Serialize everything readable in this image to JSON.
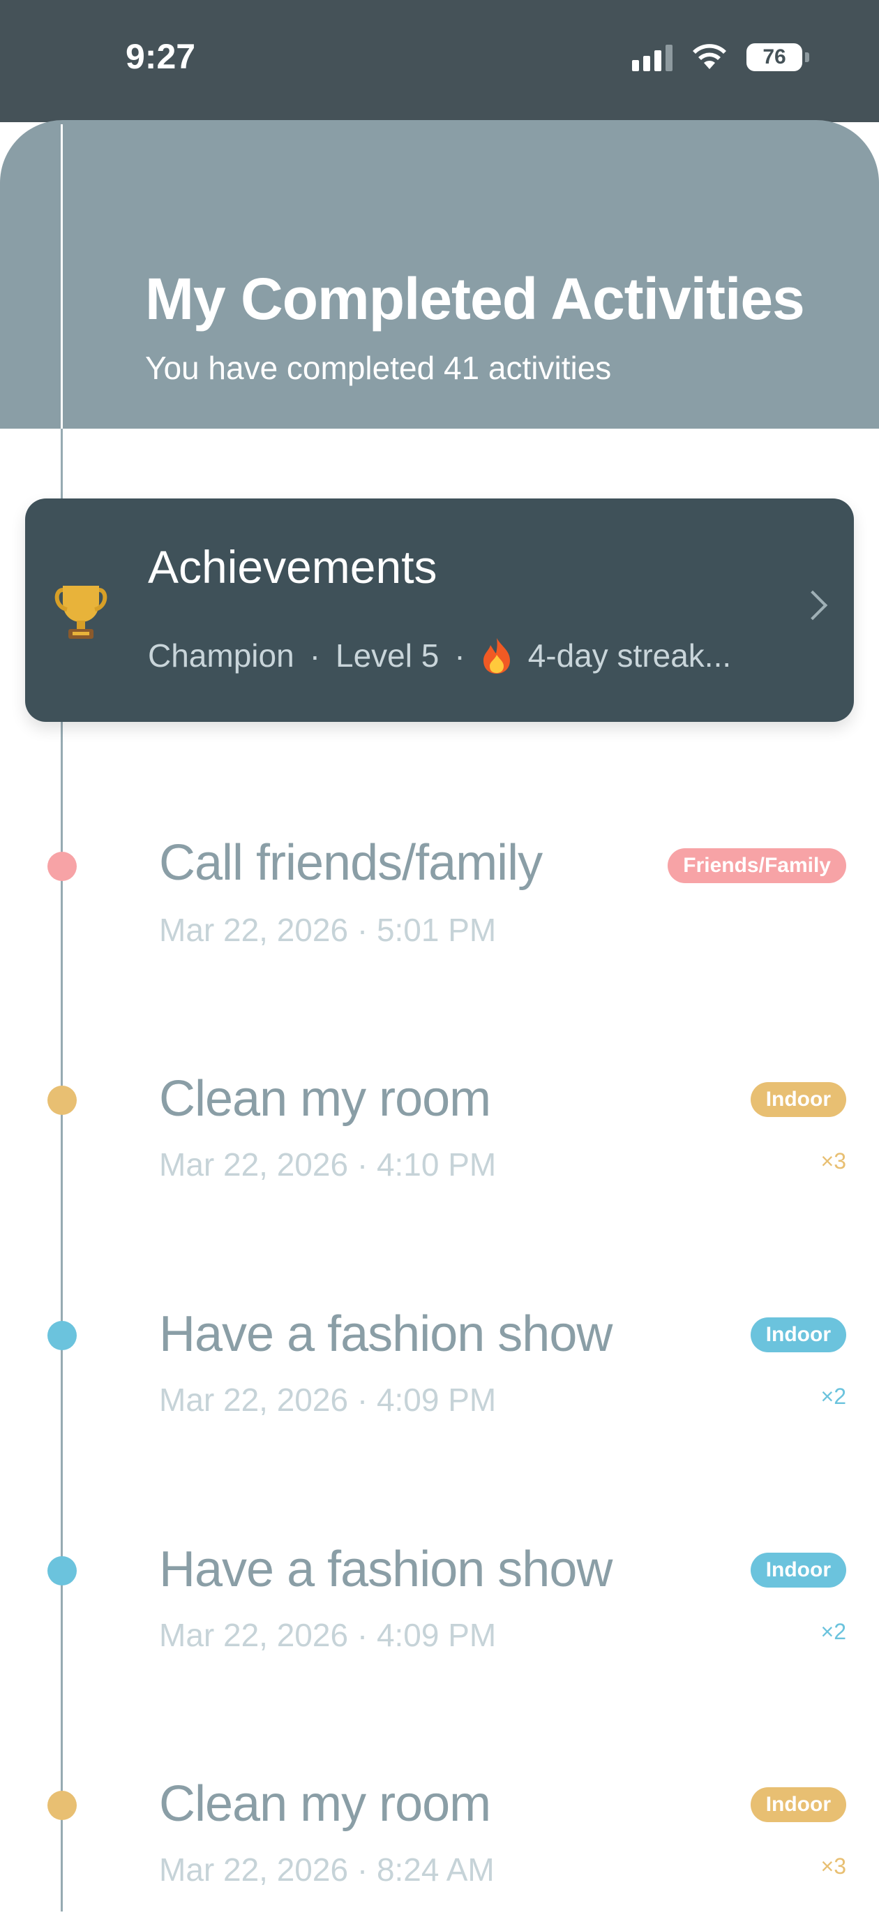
{
  "status_bar": {
    "time": "9:27",
    "battery": "76"
  },
  "header": {
    "title": "My Completed Activities",
    "subtitle": "You have completed 41 activities"
  },
  "achievements": {
    "title": "Achievements",
    "rank": "Champion",
    "separator": "·",
    "level": "Level 5",
    "streak": "4-day streak..."
  },
  "activities": [
    {
      "title": "Call friends/family",
      "date": "Mar 22, 2026 · 5:01 PM",
      "category": "Friends/Family",
      "count": ""
    },
    {
      "title": "Clean my room",
      "date": "Mar 22, 2026 · 4:10 PM",
      "category": "Indoor",
      "count": "×3"
    },
    {
      "title": "Have a fashion show",
      "date": "Mar 22, 2026 · 4:09 PM",
      "category": "Indoor",
      "count": "×2"
    },
    {
      "title": "Have a fashion show",
      "date": "Mar 22, 2026 · 4:09 PM",
      "category": "Indoor",
      "count": "×2"
    },
    {
      "title": "Clean my room",
      "date": "Mar 22, 2026 · 8:24 AM",
      "category": "Indoor",
      "count": "×3"
    }
  ],
  "colors": {
    "status_bar": "#455258",
    "header": "#8a9ea6",
    "card": "#3f5159",
    "friends_family": "#f7a3a6",
    "indoor_yellow": "#e8bf72",
    "indoor_blue": "#6bc3dd"
  },
  "icons": {
    "trophy": "trophy-icon",
    "streak": "fire-icon",
    "chevron": "chevron-right-icon"
  }
}
